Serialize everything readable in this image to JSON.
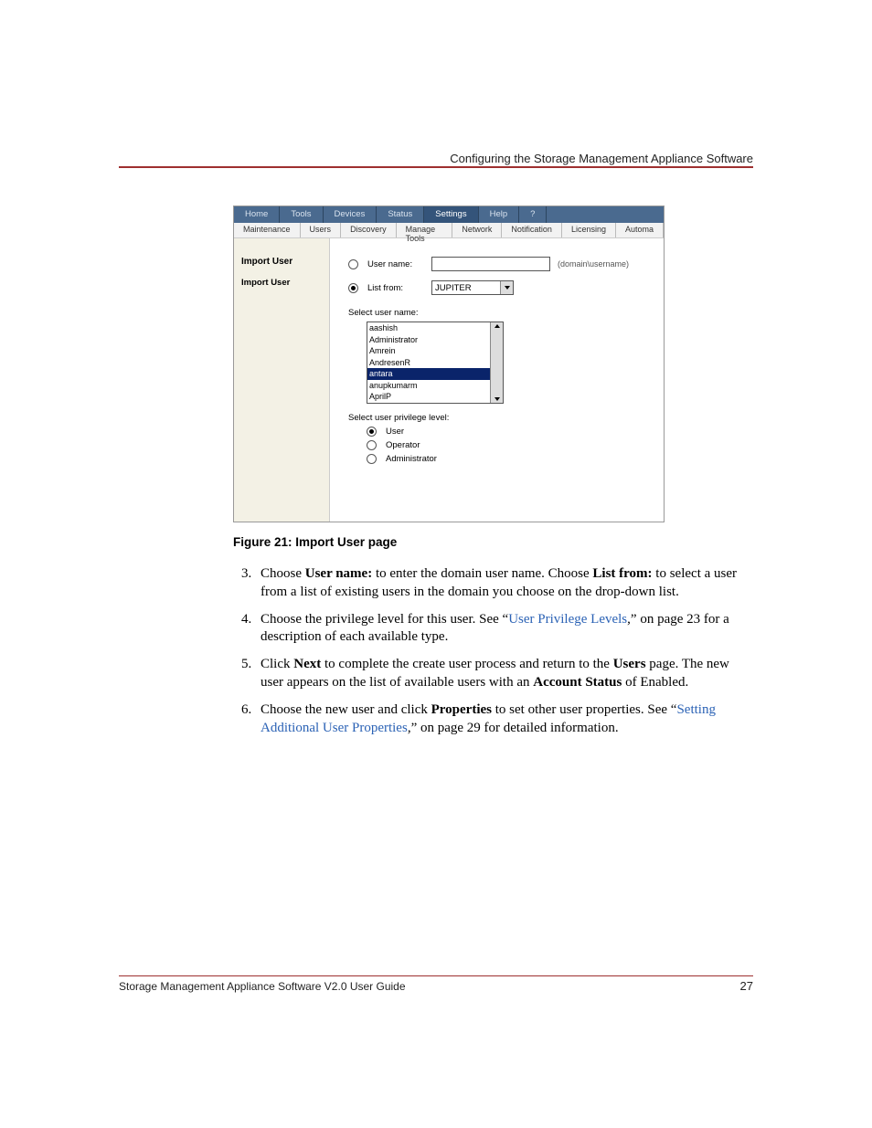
{
  "header": {
    "title": "Configuring the Storage Management Appliance Software"
  },
  "footer": {
    "left": "Storage Management Appliance Software V2.0 User Guide",
    "page": "27"
  },
  "figure": {
    "tabs_top": [
      "Home",
      "Tools",
      "Devices",
      "Status",
      "Settings",
      "Help",
      "?"
    ],
    "tabs_top_selected": "Settings",
    "tabs_sub": [
      "Maintenance",
      "Users",
      "Discovery",
      "Manage Tools",
      "Network",
      "Notification",
      "Licensing",
      "Automa"
    ],
    "left_h1": "Import User",
    "left_h2": "Import User",
    "radio_username_label": "User name:",
    "username_value": "",
    "username_hint": "(domain\\username)",
    "radio_listfrom_label": "List from:",
    "listfrom_value": "JUPITER",
    "select_username_label": "Select user name:",
    "users": [
      "aashish",
      "Administrator",
      "Amrein",
      "AndresenR",
      "antara",
      "anupkumarm",
      "AprilP"
    ],
    "users_selected": "antara",
    "select_priv_label": "Select user privilege level:",
    "priv": [
      "User",
      "Operator",
      "Administrator"
    ],
    "priv_selected": "User",
    "source_radio_selected": "listfrom"
  },
  "caption": {
    "prefix": "Figure 21:  ",
    "text": "Import User page"
  },
  "steps": {
    "s3a": "Choose ",
    "s3b": "User name:",
    "s3c": " to enter the domain user name. Choose ",
    "s3d": "List from:",
    "s3e": " to select a user from a list of existing users in the domain you choose on the drop-down list.",
    "s4a": "Choose the privilege level for this user. See “",
    "s4link": "User Privilege Levels",
    "s4b": ",” on page 23 for a description of each available type.",
    "s5a": "Click ",
    "s5b": "Next",
    "s5c": " to complete the create user process and return to the ",
    "s5d": "Users",
    "s5e": " page. The new user appears on the list of available users with an ",
    "s5f": "Account Status",
    "s5g": " of Enabled.",
    "s6a": "Choose the new user and click ",
    "s6b": "Properties",
    "s6c": " to set other user properties. See “",
    "s6link": "Setting Additional User Properties",
    "s6d": ",” on page 29 for detailed information."
  }
}
